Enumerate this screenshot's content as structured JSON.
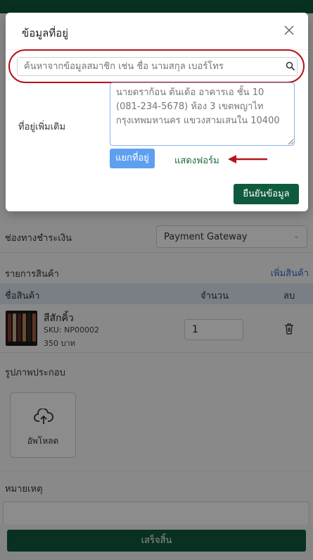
{
  "modal": {
    "title": "ข้อมูลที่อยู่",
    "search_placeholder": "ค้นหาจากข้อมูลสมาชิก เช่น ชื่อ นามสกุล เบอร์โทร",
    "address_label": "ที่อยู่เพิ่มเติม",
    "address_placeholder": "นายดราก้อน ต้นเด้อ อาคารเอ ชั้น 10 (081-234-5678) ห้อง 3 เขตพญาไท กรุงเทพมหานคร แขวงสามเสนใน 10400",
    "split_button": "แยกที่อยู่",
    "show_form_link": "แสดงฟอร์ม",
    "confirm_button": "ยืนยันข้อมูล"
  },
  "payment": {
    "label": "ช่องทางชำระเงิน",
    "selected": "Payment Gateway"
  },
  "products": {
    "section_label": "รายการสินค้า",
    "add_link": "เพิ่มสินค้า",
    "columns": {
      "name": "ชื่อสินค้า",
      "qty": "จำนวน",
      "delete": "ลบ"
    },
    "items": [
      {
        "name": "สีสักคิ้ว",
        "sku": "SKU: NP00002",
        "price": "350 บาท",
        "qty": "1"
      }
    ]
  },
  "attachments": {
    "label": "รูปภาพประกอบ",
    "upload_label": "อัพโหลด"
  },
  "note": {
    "label": "หมายเหตุ"
  },
  "footer": {
    "finish_button": "เสร็จสิ้น"
  },
  "colors": {
    "primary": "#0f5a3c",
    "accent_blue": "#5e9ff2",
    "highlight_red": "#b5141c",
    "link_green": "#1d6b3f"
  },
  "icons": {
    "close": "close-icon",
    "search": "search-icon",
    "trash": "trash-icon",
    "upload": "cloud-upload-icon",
    "arrow": "red-arrow-annotation",
    "chevron": "chevron-down-icon"
  }
}
